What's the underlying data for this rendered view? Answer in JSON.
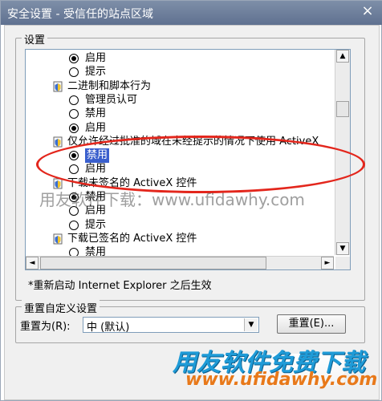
{
  "window": {
    "title": "安全设置 - 受信任的站点区域",
    "close_glyph": "×"
  },
  "settings_group": {
    "title": "设置"
  },
  "rows": [
    {
      "kind": "radio",
      "checked": true,
      "label": "启用"
    },
    {
      "kind": "radio",
      "checked": false,
      "label": "提示"
    },
    {
      "kind": "category",
      "label": "二进制和脚本行为"
    },
    {
      "kind": "radio",
      "checked": false,
      "label": "管理员认可"
    },
    {
      "kind": "radio",
      "checked": false,
      "label": "禁用"
    },
    {
      "kind": "radio",
      "checked": true,
      "label": "启用"
    },
    {
      "kind": "category",
      "label": "仅允许经过批准的域在未经提示的情况下使用 ActiveX"
    },
    {
      "kind": "radio",
      "checked": true,
      "selected": true,
      "label": "禁用"
    },
    {
      "kind": "radio",
      "checked": false,
      "label": "启用"
    },
    {
      "kind": "category",
      "label": "下载未签名的 ActiveX 控件"
    },
    {
      "kind": "radio",
      "checked": true,
      "label": "禁用"
    },
    {
      "kind": "radio",
      "checked": false,
      "label": "启用"
    },
    {
      "kind": "radio",
      "checked": false,
      "label": "提示"
    },
    {
      "kind": "category",
      "label": "下载已签名的 ActiveX 控件"
    },
    {
      "kind": "radio",
      "checked": false,
      "label": "禁用"
    }
  ],
  "scrollbar": {
    "up": "▲",
    "down": "▼",
    "left": "◄",
    "right": "►"
  },
  "note": "*重新启动 Internet Explorer 之后生效",
  "reset_group": {
    "title": "重置自定义设置",
    "label": "重置为(R):",
    "value": "中 (默认)",
    "arrow": "▼",
    "button": "重置(E)..."
  },
  "watermark": {
    "text": "用友软件下载：www.ufidawhy.com",
    "logo_cn": "用友软件免费下载",
    "logo_url": "www.ufidawhy.com"
  },
  "colors": {
    "selection": "#3a5fcd",
    "highlight": "#e3261c",
    "logo_blue": "#1f9bd7",
    "logo_orange": "#e8791a"
  }
}
